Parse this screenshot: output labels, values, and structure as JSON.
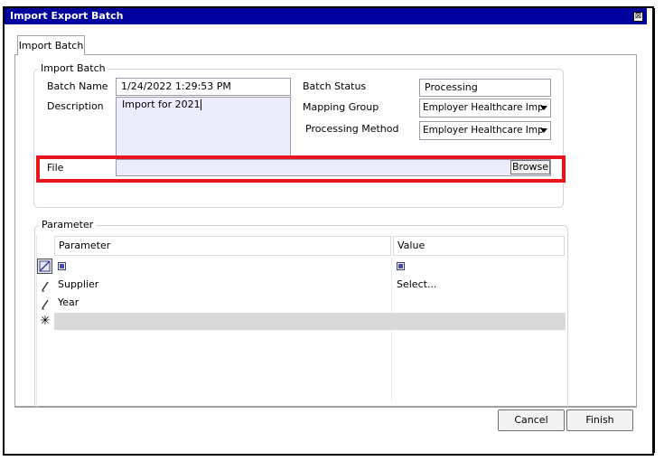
{
  "window": {
    "title": "Import Export Batch",
    "close_glyph": "⊠"
  },
  "tabs": [
    {
      "label": "Import Batch"
    }
  ],
  "import_batch": {
    "legend": "Import Batch",
    "batch_name_label": "Batch Name",
    "batch_name_value": "1/24/2022 1:29:53 PM",
    "description_label": "Description",
    "description_value": "Import for 2021",
    "batch_status_label": "Batch Status",
    "batch_status_value": "Processing",
    "mapping_group_label": "Mapping Group",
    "mapping_group_value": "Employer Healthcare Imp",
    "processing_method_label": "Processing Method",
    "processing_method_value": "Employer Healthcare Imp",
    "file_label": "File",
    "browse_label": "Browse",
    "highlight_color": "#e8141e"
  },
  "parameter_group": {
    "legend": "Parameter",
    "columns": {
      "parameter": "Parameter",
      "value": "Value"
    },
    "rows": [
      {
        "indicator": "edit-filter-icon",
        "parameter": "",
        "value": ""
      },
      {
        "indicator": "pencil-icon",
        "parameter": "Supplier",
        "value": "Select..."
      },
      {
        "indicator": "pencil-icon",
        "parameter": "Year",
        "value": ""
      },
      {
        "indicator": "asterisk-icon",
        "parameter": "",
        "value": ""
      }
    ]
  },
  "footer": {
    "cancel_label": "Cancel",
    "finish_label": "Finish"
  },
  "colors": {
    "titlebar": "#00009e",
    "field_bg": "#ececfa",
    "new_row_bg": "#d9d9d9"
  }
}
